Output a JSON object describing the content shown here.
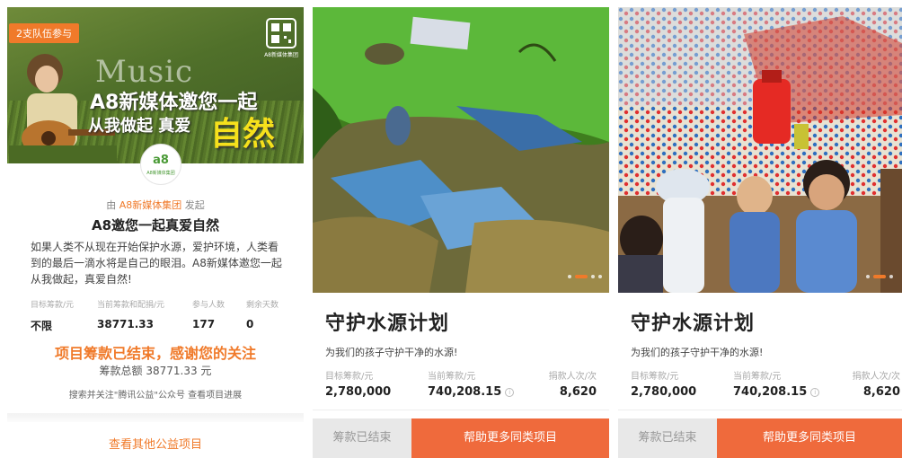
{
  "panel1": {
    "badge": "2支队伍参与",
    "hero_music": "Music",
    "hero_line1": "A8新媒体邀您一起",
    "hero_line2": "从我做起  真爱",
    "hero_ziran": "自然",
    "qr_caption": "A8新媒体集团",
    "avatar_text": "a8",
    "avatar_sub": "A8新媒体集团",
    "sponsor_prefix": "由",
    "sponsor_org": "A8新媒体集团",
    "sponsor_suffix": "发起",
    "title": "A8邀您一起真爱自然",
    "description": "如果人类不从现在开始保护水源，爱护环境，人类看到的最后一滴水将是自己的眼泪。A8新媒体邀您一起从我做起，真爱自然!",
    "stats": [
      {
        "label": "目标筹款/元",
        "value": "不限"
      },
      {
        "label": "当前筹款和配捐/元",
        "value": "38771.33"
      },
      {
        "label": "参与人数",
        "value": "177"
      },
      {
        "label": "剩余天数",
        "value": "0"
      }
    ],
    "ended_text": "项目筹款已结束，感谢您的关注",
    "total_text": "筹款总额 38771.33 元",
    "follow_text": "搜索并关注\"腾讯公益\"公众号 查看项目进展",
    "more_link": "查看其他公益项目"
  },
  "panel2": {
    "title": "守护水源计划",
    "subtitle": "为我们的孩子守护干净的水源!",
    "labels": [
      "目标筹款/元",
      "当前筹款/元",
      "捐款人次/次"
    ],
    "values": [
      "2,780,000",
      "740,208.15",
      "8,620"
    ],
    "info_glyph": "i",
    "btn_ended": "筹款已结束",
    "btn_help": "帮助更多同类项目"
  },
  "panel3": {
    "title": "守护水源计划",
    "subtitle": "为我们的孩子守护干净的水源!",
    "labels": [
      "目标筹款/元",
      "当前筹款/元",
      "捐款人次/次"
    ],
    "values": [
      "2,780,000",
      "740,208.15",
      "8,620"
    ],
    "info_glyph": "i",
    "btn_ended": "筹款已结束",
    "btn_help": "帮助更多同类项目"
  },
  "colors": {
    "accent": "#f07a2a",
    "button_help": "#ef6a3c",
    "button_disabled": "#e8e8e8",
    "hero_yellow": "#f6e01c"
  },
  "icons": [
    "qr-code-icon",
    "info-icon",
    "carousel-dot-icon"
  ]
}
